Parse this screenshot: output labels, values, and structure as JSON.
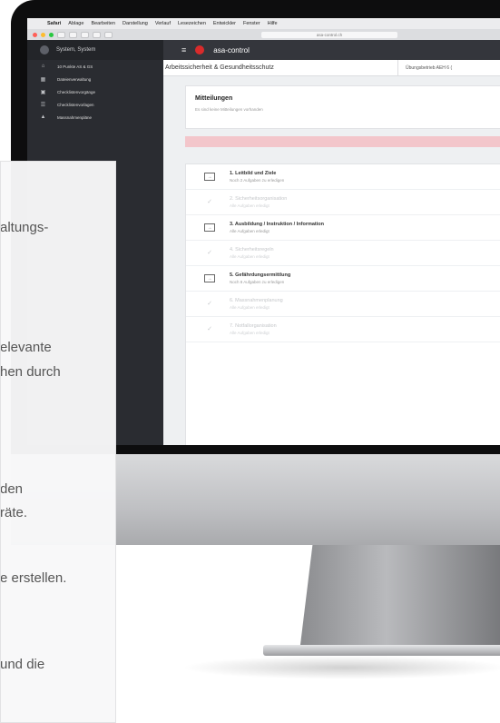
{
  "menubar": {
    "app": "Safari",
    "items": [
      "Ablage",
      "Bearbeiten",
      "Darstellung",
      "Verlauf",
      "Lesezeichen",
      "Entwickler",
      "Fenster",
      "Hilfe"
    ]
  },
  "toolbar": {
    "url": "asa-control.ch"
  },
  "sidebar": {
    "user": "System, System",
    "items": [
      {
        "icon": "home-icon",
        "label": "10 Punkte AS & GS"
      },
      {
        "icon": "table-icon",
        "label": "Dateienverwaltung"
      },
      {
        "icon": "clipboard-icon",
        "label": "Checklistenvorgänge"
      },
      {
        "icon": "list-icon",
        "label": "Checklistenvorlagen"
      },
      {
        "icon": "warning-icon",
        "label": "Massnahmenpläne"
      }
    ]
  },
  "header": {
    "brand": "asa-control"
  },
  "breadcrumb": {
    "title": "Arbeitssicherheit & Gesundheitsschutz",
    "company": "Übungsbetrieb AEH 6 ("
  },
  "messages": {
    "title": "Mitteilungen",
    "empty": "Es sind keine Mitteilungen vorhanden"
  },
  "tasks": [
    {
      "state": "open",
      "title": "1. Leitbild und Ziele",
      "sub": "Noch 2 Aufgaben zu erledigen"
    },
    {
      "state": "done",
      "title": "2. Sicherheitsorganisation",
      "sub": "Alle Aufgaben erledigt"
    },
    {
      "state": "open",
      "title": "3. Ausbildung / Instruktion / Information",
      "sub": "Alle Aufgaben erledigt"
    },
    {
      "state": "done",
      "title": "4. Sicherheitsregeln",
      "sub": "Alle Aufgaben erledigt"
    },
    {
      "state": "open",
      "title": "5. Gefährdungsermittlung",
      "sub": "Noch 8 Aufgaben zu erledigen"
    },
    {
      "state": "done",
      "title": "6. Massnahmenplanung",
      "sub": "Alle Aufgaben erledigt"
    },
    {
      "state": "done",
      "title": "7. Notfallorganisation",
      "sub": "Alle Aufgaben erledigt"
    }
  ],
  "overlay_text": {
    "line1": "altungs-",
    "line2": "elevante",
    "line3": "hen durch",
    "line4": "den",
    "line5": "räte.",
    "line6": "e erstellen.",
    "line7": "und die"
  }
}
